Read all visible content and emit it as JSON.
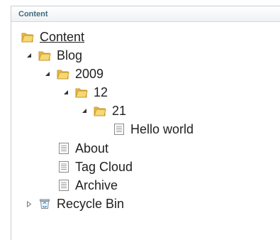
{
  "panel": {
    "title": "Content"
  },
  "tree": {
    "root": "Content",
    "blog": "Blog",
    "year": "2009",
    "month": "12",
    "day": "21",
    "post": "Hello world",
    "about": "About",
    "tag_cloud": "Tag Cloud",
    "archive": "Archive",
    "recycle_bin": "Recycle Bin"
  },
  "colors": {
    "header_text": "#3d6d7a",
    "folder": "#f1c65a",
    "border": "#c7ced4"
  }
}
